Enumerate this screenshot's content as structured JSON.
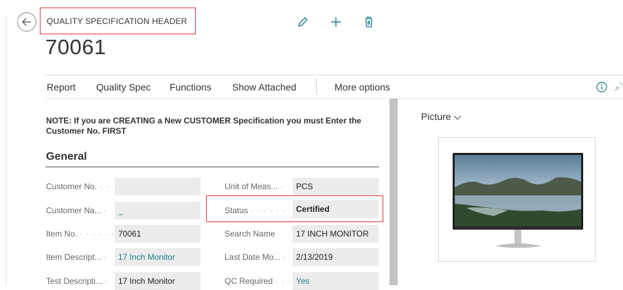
{
  "header": {
    "entity_label": "QUALITY SPECIFICATION HEADER",
    "record_number": "70061"
  },
  "actions": [
    "Report",
    "Quality Spec",
    "Functions",
    "Show Attached",
    "More options"
  ],
  "note": "NOTE: If you are CREATING a New CUSTOMER Specification you must Enter the Customer No. FIRST",
  "section": {
    "title": "General"
  },
  "fields_left": [
    {
      "label": "Customer No.",
      "value": ""
    },
    {
      "label": "Customer Na...",
      "value": "_"
    },
    {
      "label": "Item No.",
      "value": "70061"
    },
    {
      "label": "Item Descript...",
      "value": "17 Inch Monitor"
    },
    {
      "label": "Test Descripti...",
      "value": "17 Inch Monitor"
    }
  ],
  "fields_right": [
    {
      "label": "Unit of Meas...",
      "value": "PCS"
    },
    {
      "label": "Status",
      "value": "Certified"
    },
    {
      "label": "Search Name",
      "value": "17 INCH MONITOR"
    },
    {
      "label": "Last Date Mo...",
      "value": "2/13/2019"
    },
    {
      "label": "QC Required",
      "value": "Yes"
    }
  ],
  "factbox": {
    "title": "Picture"
  },
  "colors": {
    "highlight": "#e5393a",
    "accent": "#1d7e8c",
    "field_bg": "#ececec"
  },
  "icons": [
    "back-arrow-icon",
    "edit-pencil-icon",
    "new-plus-icon",
    "delete-trash-icon",
    "info-icon",
    "collapse-icon",
    "chevron-down-icon"
  ]
}
